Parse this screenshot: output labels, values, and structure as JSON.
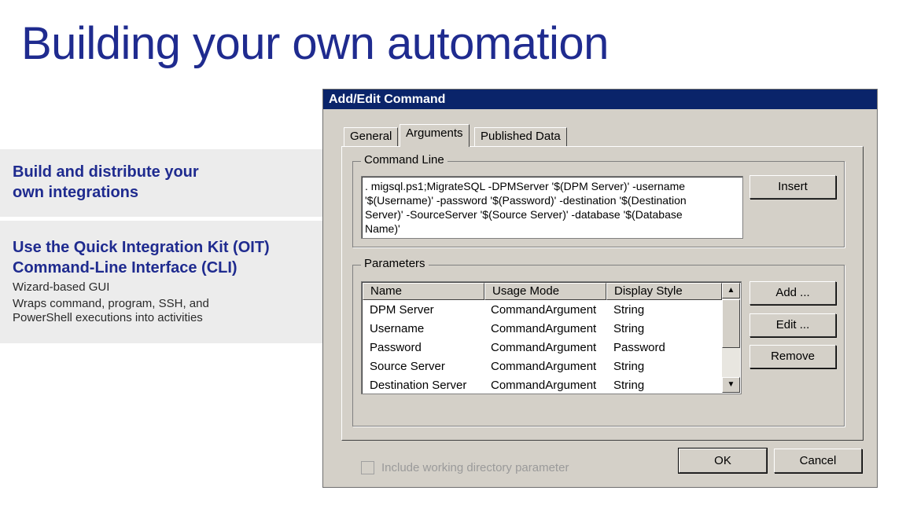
{
  "slide": {
    "title": "Building your own automation",
    "panel1": {
      "heading": [
        "Build and distribute your",
        "own integrations"
      ]
    },
    "panel2": {
      "heading": [
        "Use the Quick Integration Kit (OIT)",
        "Command-Line Interface (CLI)"
      ],
      "lines": [
        "Wizard-based GUI",
        "Wraps command, program, SSH, and",
        "PowerShell executions into activities"
      ]
    }
  },
  "dialog": {
    "title": "Add/Edit Command",
    "tabs": [
      {
        "label": "General",
        "active": false
      },
      {
        "label": "Arguments",
        "active": true
      },
      {
        "label": "Published Data",
        "active": false
      }
    ],
    "command_line": {
      "label": "Command Line",
      "lines": [
        ". migsql.ps1;MigrateSQL -DPMServer '$(DPM Server)' -username",
        "'$(Username)' -password '$(Password)' -destination '$(Destination",
        "Server)' -SourceServer '$(Source Server)' -database '$(Database",
        "Name)'"
      ],
      "insert_label": "Insert"
    },
    "parameters": {
      "label": "Parameters",
      "columns": [
        "Name",
        "Usage Mode",
        "Display Style"
      ],
      "rows": [
        [
          "DPM Server",
          "CommandArgument",
          "String"
        ],
        [
          "Username",
          "CommandArgument",
          "String"
        ],
        [
          "Password",
          "CommandArgument",
          "Password"
        ],
        [
          "Source Server",
          "CommandArgument",
          "String"
        ],
        [
          "Destination Server",
          "CommandArgument",
          "String"
        ]
      ],
      "add_label": "Add ...",
      "edit_label": "Edit ...",
      "remove_label": "Remove"
    },
    "include_working_dir": {
      "label": "Include working directory parameter",
      "checked": false,
      "enabled": false
    },
    "ok_label": "OK",
    "cancel_label": "Cancel"
  },
  "colors": {
    "title_blue": "#1f2b8f",
    "titlebar": "#0a246a",
    "dialog_face": "#d4d0c8",
    "panel_bg": "#ececec"
  }
}
